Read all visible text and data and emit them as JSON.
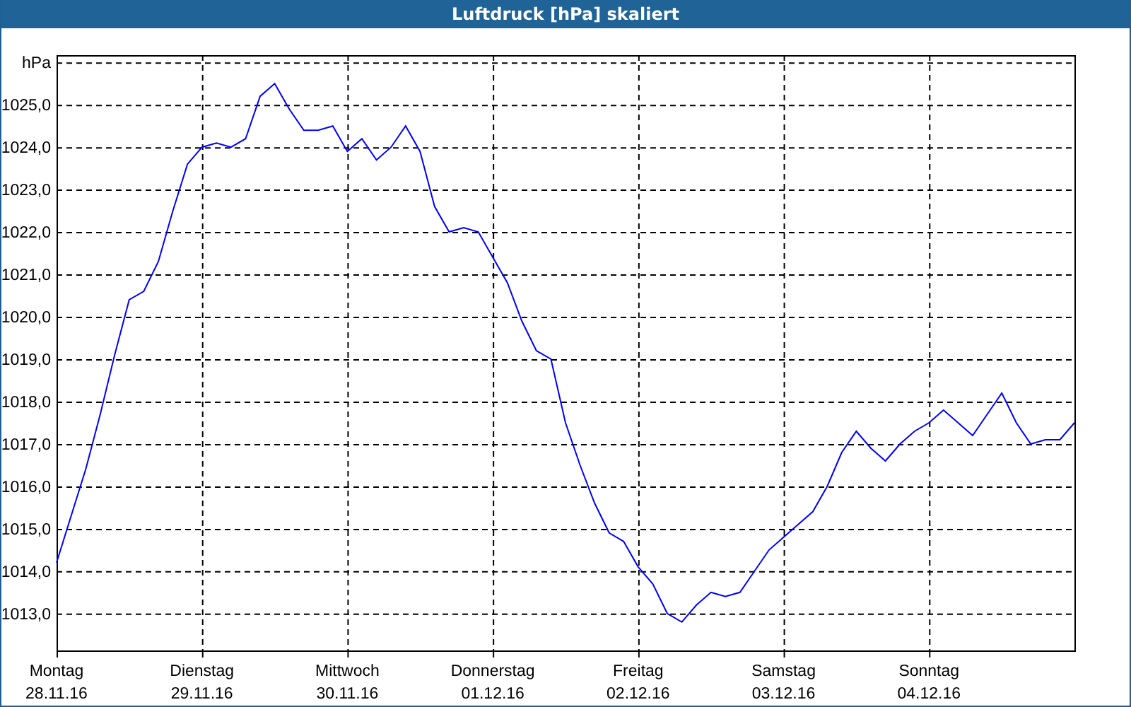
{
  "window": {
    "title": "Luftdruck [hPa] skaliert"
  },
  "chart": {
    "date_labels": [
      "28.11.16",
      "29.11.16",
      "30.11.16",
      "01.12.16",
      "02.12.16",
      "03.12.16",
      "04.12.16"
    ],
    "chart_data": {
      "type": "line",
      "grid": true,
      "categories": [
        "Montag",
        null,
        null,
        null,
        null,
        null,
        null,
        null,
        null,
        null,
        "Dienstag",
        null,
        null,
        null,
        null,
        null,
        null,
        null,
        null,
        null,
        "Mittwoch",
        null,
        null,
        null,
        null,
        null,
        null,
        null,
        null,
        null,
        "Donnerstag",
        null,
        null,
        null,
        null,
        null,
        null,
        null,
        null,
        null,
        "Freitag",
        null,
        null,
        null,
        null,
        null,
        null,
        null,
        null,
        null,
        "Samstag",
        null,
        null,
        null,
        null,
        null,
        null,
        null,
        null,
        null,
        "Sonntag",
        null,
        null,
        null,
        null,
        null,
        null,
        null,
        null,
        null,
        null
      ],
      "values": [
        1014.2,
        1015.3,
        1016.4,
        1017.7,
        1019.1,
        1020.4,
        1020.6,
        1021.3,
        1022.5,
        1023.6,
        1024.0,
        1024.1,
        1024.0,
        1024.2,
        1025.2,
        1025.5,
        1024.9,
        1024.4,
        1024.4,
        1024.5,
        1023.9,
        1024.2,
        1023.7,
        1024.0,
        1024.5,
        1023.9,
        1022.6,
        1022.0,
        1022.1,
        1022.0,
        1021.4,
        1020.8,
        1019.9,
        1019.2,
        1019.0,
        1017.5,
        1016.5,
        1015.6,
        1014.9,
        1014.7,
        1014.1,
        1013.7,
        1013.0,
        1012.8,
        1013.2,
        1013.5,
        1013.4,
        1013.5,
        1014.0,
        1014.5,
        1014.8,
        1015.1,
        1015.4,
        1016.0,
        1016.8,
        1017.3,
        1016.9,
        1016.6,
        1017.0,
        1017.3,
        1017.5,
        1017.8,
        1017.5,
        1017.2,
        1017.7,
        1018.2,
        1017.5,
        1017.0,
        1017.1,
        1017.1,
        1017.5
      ],
      "ylim": [
        1012.13,
        1026.17
      ],
      "yticks": [
        {
          "value": 1013,
          "label": "1013,0"
        },
        {
          "value": 1014,
          "label": "1014,0"
        },
        {
          "value": 1015,
          "label": "1015,0"
        },
        {
          "value": 1016,
          "label": "1016,0"
        },
        {
          "value": 1017,
          "label": "1017,0"
        },
        {
          "value": 1018,
          "label": "1018,0"
        },
        {
          "value": 1019,
          "label": "1019,0"
        },
        {
          "value": 1020,
          "label": "1020,0"
        },
        {
          "value": 1021,
          "label": "1021,0"
        },
        {
          "value": 1022,
          "label": "1022,0"
        },
        {
          "value": 1023,
          "label": "1023,0"
        },
        {
          "value": 1024,
          "label": "1024,0"
        },
        {
          "value": 1025,
          "label": "1025,0"
        },
        {
          "value": 1026,
          "label": "hPa"
        }
      ]
    }
  }
}
